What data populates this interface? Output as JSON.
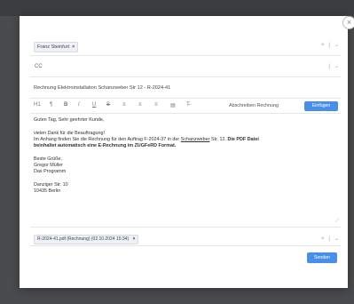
{
  "recipient": {
    "name": "Franz Steinfurt",
    "remove": "×"
  },
  "cc": {
    "label": "CC"
  },
  "row_controls": {
    "clear": "×",
    "sep": "|",
    "expand": "⌄"
  },
  "subject": "Rechnung Elektroinstallation Schanzweber Str 12 - R-2024-41",
  "toolbar": {
    "items": [
      "H1",
      "¶",
      "B",
      "I",
      "U",
      "S",
      "≡",
      "≡",
      "≡",
      "▤",
      "T̶"
    ],
    "signature_select": "Abschreiben Rechnung",
    "insert_label": "Einfügen"
  },
  "body": {
    "greeting": "Guten Tag, Sehr geehrter Kunde,",
    "line1": "vielen Dank für die Beauftragung!",
    "line2_a": "Im Anhang finden Sie die Rechnung für den Auftrag F-2024-37 in der",
    "line2_u": "Schanzweber",
    "line2_b": "Str. 12.",
    "line2_bold": "Die PDF Datei",
    "line3_bold": "beinhaltet automatisch eine E-Rechnung im ZUGFeRD Format.",
    "closing": "Beste Grüße,",
    "signer": "Gregor Müller",
    "company": "Das Programm",
    "street": "Danziger Str. 10",
    "city": "10435 Berlin"
  },
  "attachment": {
    "filename": "R-2024-41.pdf (Rechnung) (02.10.2024 15:34)",
    "remove": "×"
  },
  "send_label": "Senden",
  "close_label": "×"
}
